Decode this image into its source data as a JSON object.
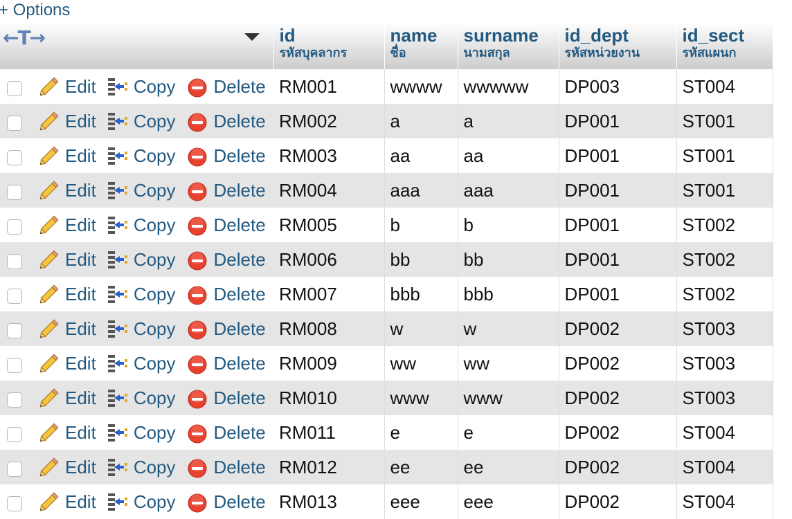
{
  "options_label": "+ Options",
  "controls": {
    "arrows_glyph": "←T→"
  },
  "columns": [
    {
      "name": "id",
      "comment": "รหัสบุคลากร"
    },
    {
      "name": "name",
      "comment": "ชื่อ"
    },
    {
      "name": "surname",
      "comment": "นามสกุล"
    },
    {
      "name": "id_dept",
      "comment": "รหัสหน่วยงาน"
    },
    {
      "name": "id_sect",
      "comment": "รหัสแผนก"
    }
  ],
  "actions": {
    "edit": "Edit",
    "copy": "Copy",
    "delete": "Delete"
  },
  "rows": [
    [
      "RM001",
      "wwww",
      "wwwww",
      "DP003",
      "ST004"
    ],
    [
      "RM002",
      "a",
      "a",
      "DP001",
      "ST001"
    ],
    [
      "RM003",
      "aa",
      "aa",
      "DP001",
      "ST001"
    ],
    [
      "RM004",
      "aaa",
      "aaa",
      "DP001",
      "ST001"
    ],
    [
      "RM005",
      "b",
      "b",
      "DP001",
      "ST002"
    ],
    [
      "RM006",
      "bb",
      "bb",
      "DP001",
      "ST002"
    ],
    [
      "RM007",
      "bbb",
      "bbb",
      "DP001",
      "ST002"
    ],
    [
      "RM008",
      "w",
      "w",
      "DP002",
      "ST003"
    ],
    [
      "RM009",
      "ww",
      "ww",
      "DP002",
      "ST003"
    ],
    [
      "RM010",
      "www",
      "www",
      "DP002",
      "ST003"
    ],
    [
      "RM011",
      "e",
      "e",
      "DP002",
      "ST004"
    ],
    [
      "RM012",
      "ee",
      "ee",
      "DP002",
      "ST004"
    ],
    [
      "RM013",
      "eee",
      "eee",
      "DP002",
      "ST004"
    ]
  ],
  "colors": {
    "link": "#235a81",
    "row_alt": "#e5e5e5",
    "delete_red": "#e8412e"
  }
}
